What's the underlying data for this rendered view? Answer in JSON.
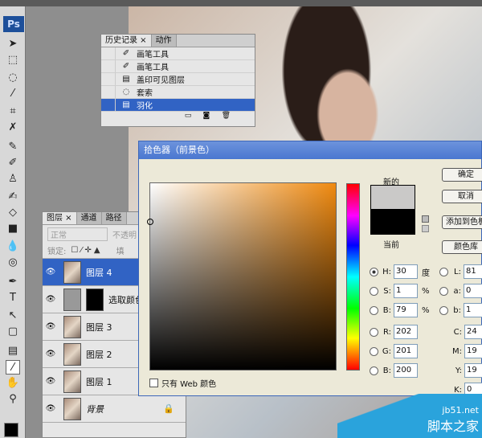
{
  "app": {
    "logo": "Ps"
  },
  "toolbar": {
    "tools": [
      "move-icon",
      "marquee-icon",
      "lasso-icon",
      "magic-wand-icon",
      "crop-icon",
      "eyedropper-slice-icon",
      "healing-icon",
      "brush-icon",
      "stamp-icon",
      "history-brush-icon",
      "eraser-icon",
      "gradient-icon",
      "blur-icon",
      "dodge-icon",
      "pen-icon",
      "type-icon",
      "path-select-icon",
      "shape-icon",
      "notes-icon",
      "eyedropper-icon",
      "hand-icon",
      "zoom-icon"
    ],
    "type_glyph": "T",
    "foreground": "#000000"
  },
  "history": {
    "tabs": [
      "历史记录 ×",
      "动作"
    ],
    "items": [
      {
        "icon": "brush-icon",
        "label": "画笔工具"
      },
      {
        "icon": "brush-icon",
        "label": "画笔工具"
      },
      {
        "icon": "stamp-visible-icon",
        "label": "盖印可见图层"
      },
      {
        "icon": "lasso-icon",
        "label": "套索"
      },
      {
        "icon": "feather-icon",
        "label": "羽化",
        "selected": true
      }
    ]
  },
  "layers": {
    "tabs": [
      "图层 ×",
      "通道",
      "路径"
    ],
    "blend_mode": "正常",
    "opacity_label": "不透明",
    "lock_label": "锁定:",
    "fill_label": "填",
    "items": [
      {
        "label": "图层 4",
        "selected": true
      },
      {
        "label": "选取颜色",
        "adjustment": true
      },
      {
        "label": "图层 3"
      },
      {
        "label": "图层 2"
      },
      {
        "label": "图层 1"
      },
      {
        "label": "背景",
        "locked": true
      }
    ]
  },
  "color_picker": {
    "title": "拾色器（前景色）",
    "new_label": "新的",
    "current_label": "当前",
    "new_color": "#cac9c8",
    "current_color": "#000000",
    "buttons": [
      "确定",
      "取消",
      "添加到色板",
      "颜色库"
    ],
    "web_only_label": "只有 Web 颜色",
    "hsb": [
      {
        "label": "H:",
        "value": "30",
        "unit": "度",
        "checked": true
      },
      {
        "label": "S:",
        "value": "1",
        "unit": "%"
      },
      {
        "label": "B:",
        "value": "79",
        "unit": "%"
      }
    ],
    "lab": [
      {
        "label": "L:",
        "value": "81"
      },
      {
        "label": "a:",
        "value": "0"
      },
      {
        "label": "b:",
        "value": "1"
      }
    ],
    "rgb": [
      {
        "label": "R:",
        "value": "202"
      },
      {
        "label": "G:",
        "value": "201"
      },
      {
        "label": "B:",
        "value": "200"
      }
    ],
    "cmyk": [
      {
        "label": "C:",
        "value": "24"
      },
      {
        "label": "M:",
        "value": "19"
      },
      {
        "label": "Y:",
        "value": "19"
      },
      {
        "label": "K:",
        "value": "0"
      }
    ]
  },
  "watermark": {
    "line1": "jb51.net",
    "line2": "脚本之家"
  }
}
